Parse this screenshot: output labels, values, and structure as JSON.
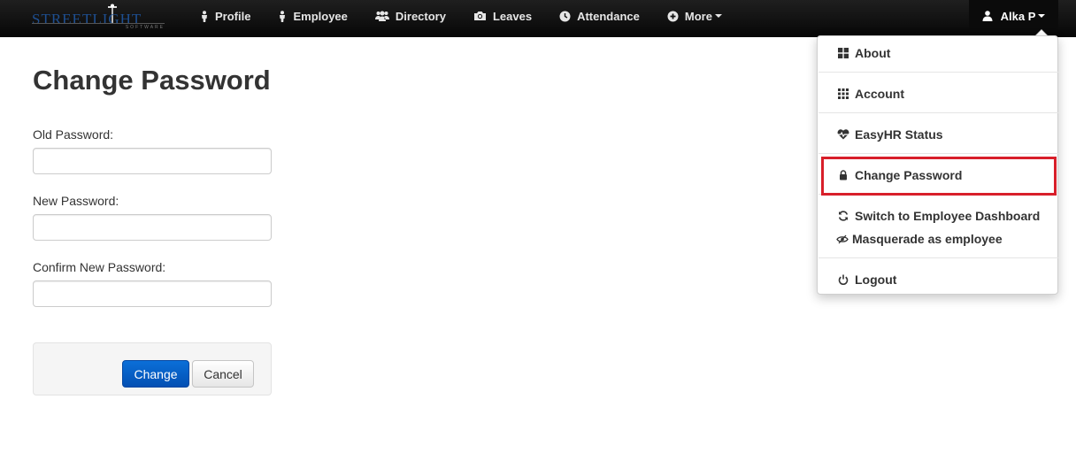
{
  "brand": {
    "logo_word": "STREETLIGHT",
    "logo_sub": "SOFTWARE"
  },
  "nav": {
    "items": [
      {
        "label": "Profile",
        "icon": "person-icon"
      },
      {
        "label": "Employee",
        "icon": "person-icon"
      },
      {
        "label": "Directory",
        "icon": "users-icon"
      },
      {
        "label": "Leaves",
        "icon": "camera-icon"
      },
      {
        "label": "Attendance",
        "icon": "clock-icon"
      },
      {
        "label": "More",
        "icon": "plus-circle-icon"
      }
    ],
    "user": {
      "label": "Alka P",
      "icon": "user-icon"
    }
  },
  "page": {
    "title": "Change Password",
    "fields": [
      {
        "label": "Old Password:",
        "value": ""
      },
      {
        "label": "New Password:",
        "value": ""
      },
      {
        "label": "Confirm New Password:",
        "value": ""
      }
    ],
    "buttons": {
      "primary": "Change",
      "secondary": "Cancel"
    }
  },
  "dropdown": {
    "items": [
      {
        "label": "About",
        "icon": "grid-icon"
      },
      {
        "label": "Account",
        "icon": "grid-dots-icon"
      },
      {
        "label": "EasyHR Status",
        "icon": "heartbeat-icon"
      },
      {
        "label": "Change Password",
        "icon": "lock-icon",
        "highlighted": true
      },
      {
        "label": "Switch to Employee Dashboard",
        "icon": "refresh-icon"
      },
      {
        "label": "Masquerade as employee",
        "icon": "eye-slash-icon"
      },
      {
        "label": "Logout",
        "icon": "power-icon"
      }
    ]
  },
  "colors": {
    "navbar": "#111111",
    "primary_button": "#0a66cc",
    "highlight": "#d81f2a"
  }
}
